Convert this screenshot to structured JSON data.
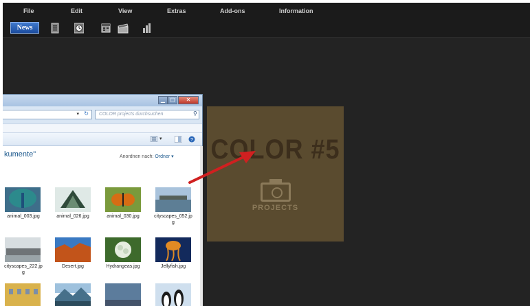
{
  "menubar": {
    "items": [
      {
        "label": "File"
      },
      {
        "label": "Edit"
      },
      {
        "label": "View"
      },
      {
        "label": "Extras"
      },
      {
        "label": "Add-ons"
      },
      {
        "label": "Information"
      }
    ]
  },
  "toolbar": {
    "news_label": "News"
  },
  "preview": {
    "title": "COLOR #5",
    "subtitle": "PROJECTS"
  },
  "explorer": {
    "search_placeholder": "COLOR projects durchsuchen",
    "folder_title": "kumente\"",
    "arrange_label": "Anordnen nach:",
    "arrange_value": "Ordner",
    "files": [
      {
        "name": "animal_003.jpg"
      },
      {
        "name": "animal_026.jpg"
      },
      {
        "name": "animal_030.jpg"
      },
      {
        "name": "cityscapes_052.jp\ng"
      },
      {
        "name": "cityscapes_222.jp\ng"
      },
      {
        "name": "Desert.jpg"
      },
      {
        "name": "Hydrangeas.jpg"
      },
      {
        "name": "Jellyfish.jpg"
      },
      {
        "name": ""
      },
      {
        "name": ""
      },
      {
        "name": ""
      },
      {
        "name": ""
      }
    ]
  },
  "colors": {
    "app_bg": "#232323",
    "accent_arrow": "#d02020",
    "preview_bg": "#5a4b2f"
  }
}
